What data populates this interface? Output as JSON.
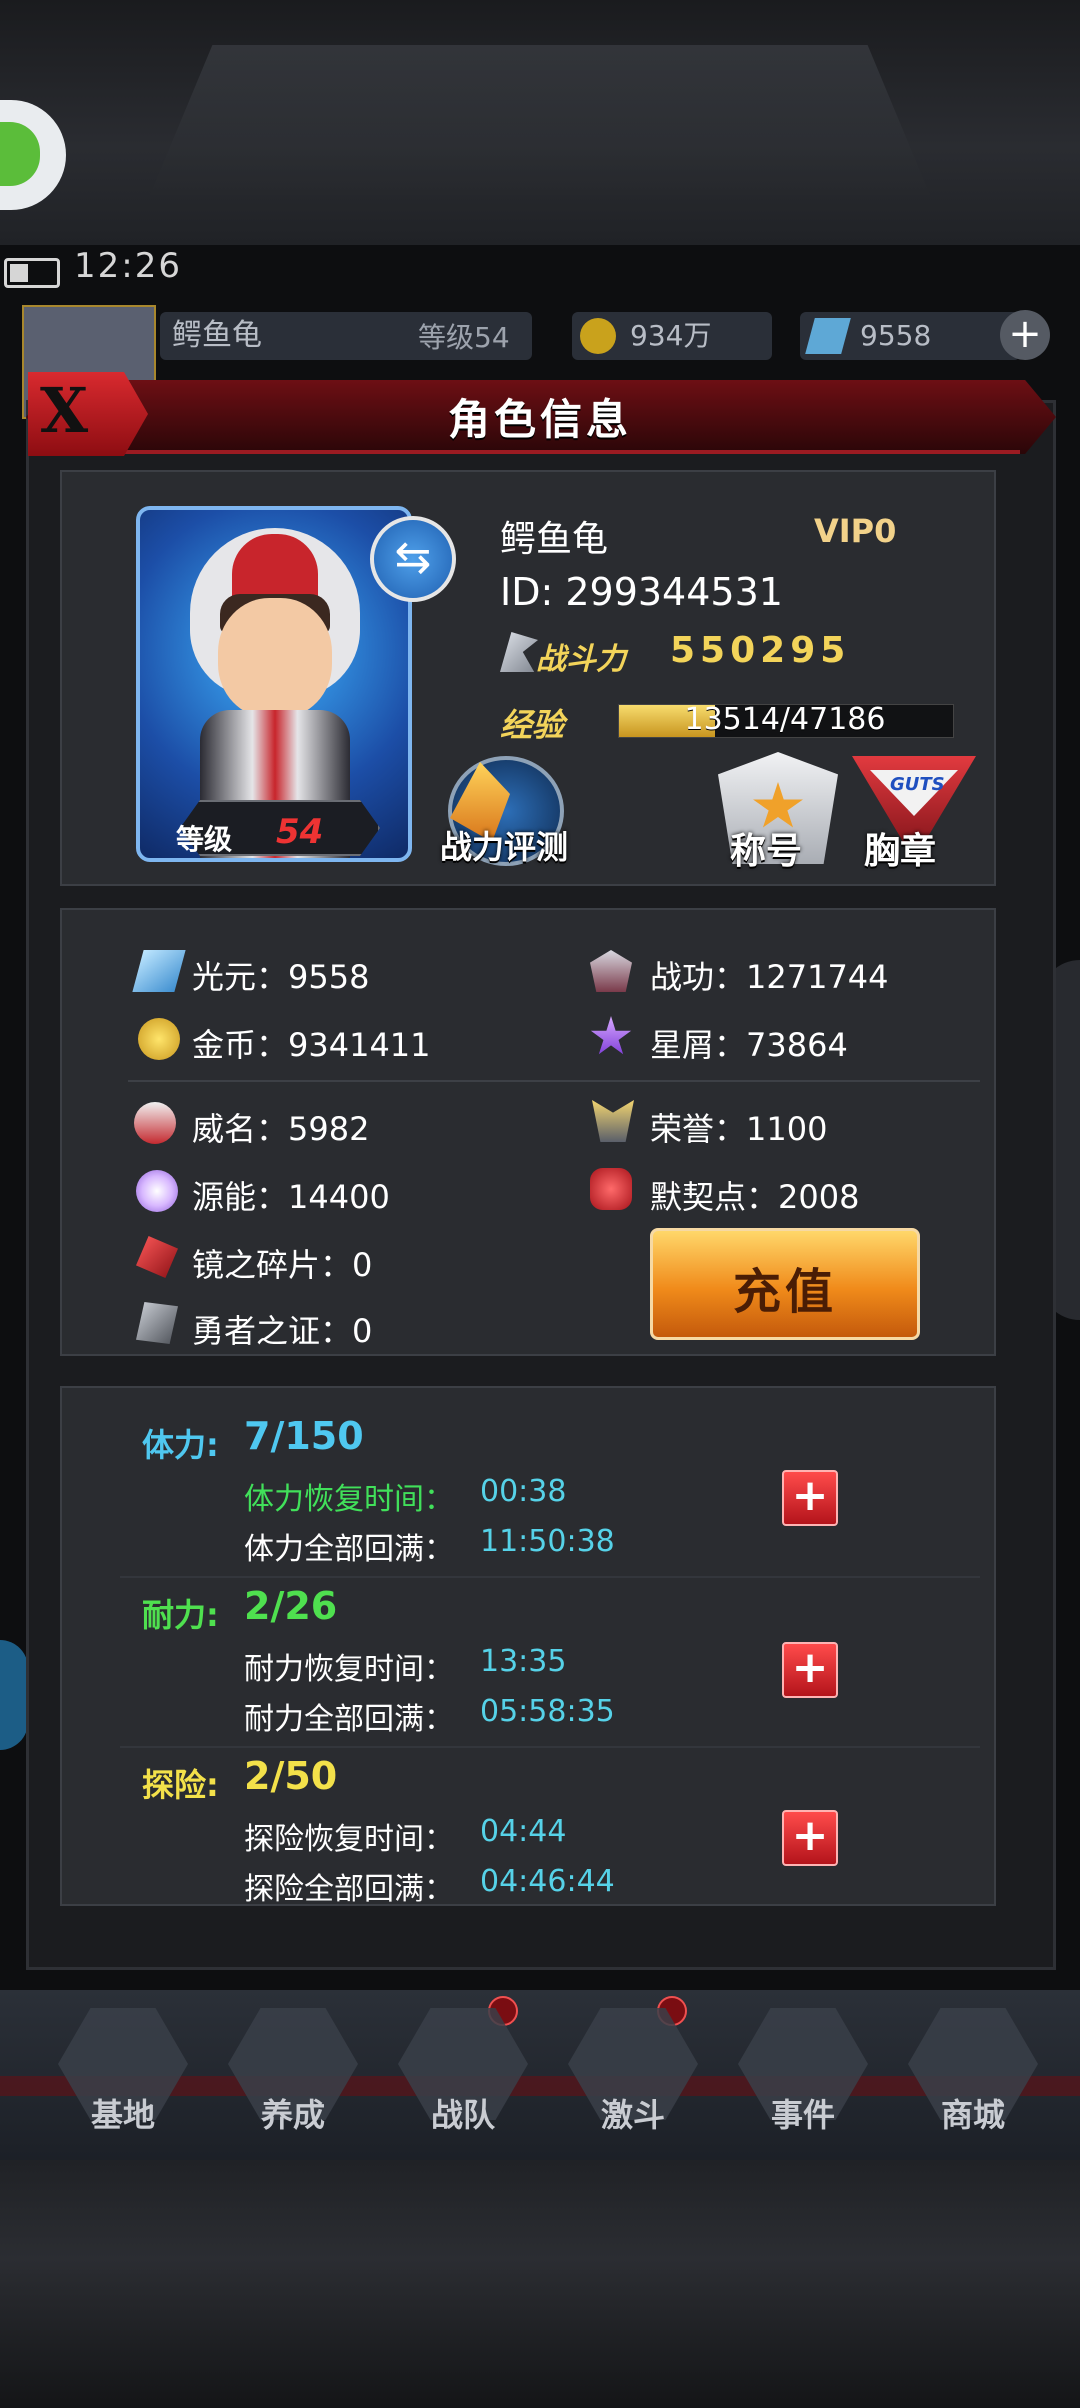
{
  "status_bar": {
    "time": "12:26"
  },
  "top_bar": {
    "player_name": "鳄鱼龟",
    "level_text": "等级54",
    "gold": "934万",
    "gems": "9558"
  },
  "dialog": {
    "title": "角色信息",
    "close_label": "X"
  },
  "profile": {
    "name": "鳄鱼龟",
    "vip": "VIP0",
    "id": "ID: 299344531",
    "power_label": "战斗力",
    "power_value": "550295",
    "exp_label": "经验",
    "exp_text": "13514/47186",
    "exp_fraction": 0.2864,
    "level_label": "等级",
    "level_value": "54",
    "buttons": {
      "power_eval": "战力评测",
      "title": "称号",
      "badge": "胸章",
      "badge_logo": "GUTS"
    }
  },
  "resources": {
    "guangyuan": "光元：9558",
    "zhangong": "战功：1271744",
    "gold": "金币：9341411",
    "xingxie": "星屑：73864",
    "weiming": "威名：5982",
    "rongyu": "荣誉：1100",
    "yuanneng": "源能：14400",
    "moqidian": "默契点：2008",
    "mirror_shard": "镜之碎片：0",
    "hero_proof": "勇者之证：0",
    "recharge_label": "充值"
  },
  "stamina": [
    {
      "name": "体力:",
      "value": "7/150",
      "color": "#4fc8f0",
      "recover_label": "体力恢复时间：",
      "recover_time": "00:38",
      "recover_color": "#41e05a",
      "full_label": "体力全部回满：",
      "full_time": "11:50:38"
    },
    {
      "name": "耐力:",
      "value": "2/26",
      "color": "#4fe04f",
      "recover_label": "耐力恢复时间：",
      "recover_time": "13:35",
      "recover_color": "#ffffff",
      "full_label": "耐力全部回满：",
      "full_time": "05:58:35"
    },
    {
      "name": "探险:",
      "value": "2/50",
      "color": "#f3e14a",
      "recover_label": "探险恢复时间：",
      "recover_time": "04:44",
      "recover_color": "#ffffff",
      "full_label": "探险全部回满：",
      "full_time": "04:46:44"
    }
  ],
  "nav": [
    {
      "label": "基地"
    },
    {
      "label": "养成"
    },
    {
      "label": "战队"
    },
    {
      "label": "激斗"
    },
    {
      "label": "事件"
    },
    {
      "label": "商城"
    }
  ],
  "colors": {
    "accent_red": "#c8252c",
    "gold_text": "#f3d45a",
    "time_cyan": "#56d2e8"
  }
}
